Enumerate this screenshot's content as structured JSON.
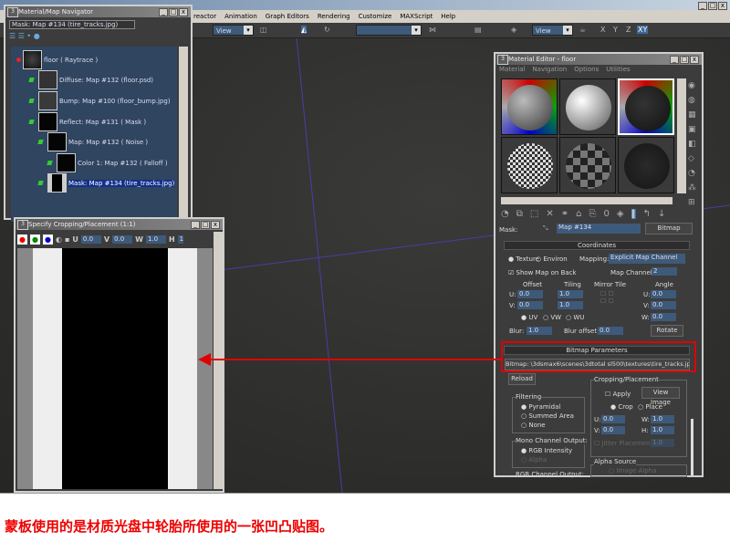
{
  "app": {
    "menu": [
      "reactor",
      "Animation",
      "Graph Editors",
      "Rendering",
      "Customize",
      "MAXScript",
      "Help"
    ],
    "toolbar": {
      "view_combo_1": "View",
      "view_combo_2": "View",
      "axes": [
        "X",
        "Y",
        "Z",
        "XY"
      ]
    }
  },
  "navigator": {
    "title": "Material/Map Navigator",
    "path": "Mask: Map #134 (tire_tracks.jpg)",
    "nodes": [
      "floor  ( Raytrace )",
      "Diffuse: Map #132 (floor.psd)",
      "Bump: Map #100 (floor_bump.jpg)",
      "Reflect: Map #131  ( Mask )",
      "Map: Map #132  ( Noise )",
      "Color 1: Map #132  ( Falloff )",
      "Mask: Map #134 (tire_tracks.jpg)"
    ]
  },
  "cropping": {
    "title": "Specify Cropping/Placement (1:1)",
    "u_label": "U",
    "u": "0.0",
    "v_label": "V",
    "v": "0.0",
    "w_label": "W",
    "w": "1.0",
    "h_label": "H",
    "h": "1"
  },
  "material_editor": {
    "title": "Material Editor - floor",
    "menu": [
      "Material",
      "Navigation",
      "Options",
      "Utilities"
    ],
    "mask_label": "Mask:",
    "map_name": "Map #134",
    "map_type": "Bitmap",
    "coordinates": {
      "title": "Coordinates",
      "texture": "Texture",
      "environ": "Environ",
      "mapping_label": "Mapping:",
      "mapping": "Explicit Map Channel",
      "show_map_on_back": "Show Map on Back",
      "map_channel_label": "Map Channel:",
      "map_channel": "2",
      "offset": "Offset",
      "tiling": "Tiling",
      "mirror_tile": "Mirror Tile",
      "angle": "Angle",
      "u": "U:",
      "v": "V:",
      "w": "W:",
      "offset_u": "0.0",
      "offset_v": "0.0",
      "tiling_u": "1.0",
      "tiling_v": "1.0",
      "angle_u": "0.0",
      "angle_v": "0.0",
      "angle_w": "0.0",
      "uv": "UV",
      "vw": "VW",
      "wu": "WU",
      "blur_label": "Blur:",
      "blur": "1.0",
      "blur_offset_label": "Blur offset:",
      "blur_offset": "0.0",
      "rotate": "Rotate"
    },
    "bitmap_params": {
      "title": "Bitmap Parameters",
      "bitmap": "Bitmap:  \\3dsmax6\\scenes\\3dtotal sl500\\textures\\tire_tracks.jpg",
      "reload": "Reload",
      "filtering": "Filtering",
      "pyramidal": "Pyramidal",
      "summed_area": "Summed Area",
      "none": "None",
      "mono_output": "Mono Channel Output:",
      "rgb_intensity": "RGB Intensity",
      "alpha": "Alpha",
      "rgb_output": "RGB Channel Output:",
      "cropping": "Cropping/Placement",
      "apply": "Apply",
      "view_image": "View Image",
      "crop": "Crop",
      "place": "Place",
      "u": "U:",
      "u_val": "0.0",
      "v": "V:",
      "v_val": "0.0",
      "w": "W:",
      "w_val": "1.0",
      "h": "H:",
      "h_val": "1.0",
      "jitter": "Jitter Placement:",
      "jitter_val": "1.0",
      "alpha_source": "Alpha Source",
      "image_alpha": "Image Alpha"
    }
  },
  "caption": "蒙板使用的是材质光盘中轮胎所使用的一张凹凸贴图。",
  "colors": {
    "annotation": "#e00000",
    "selection": "#13318a",
    "field": "#3e5a7a"
  }
}
